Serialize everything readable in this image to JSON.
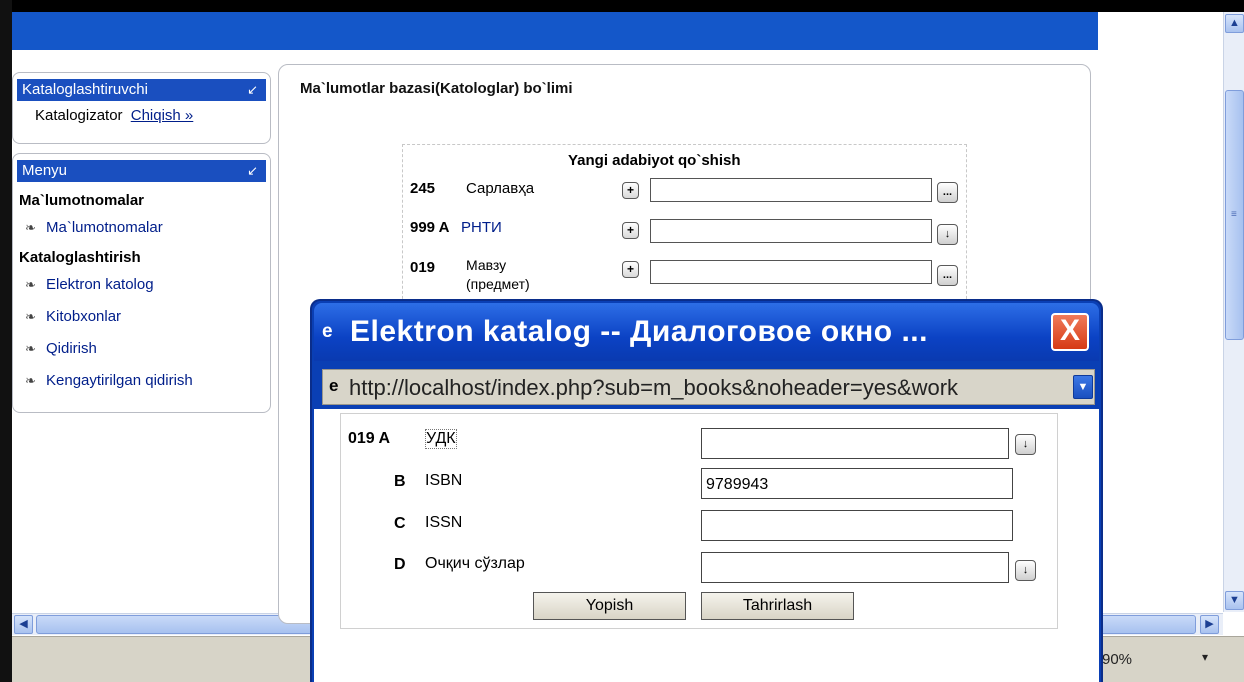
{
  "browser": {
    "zoom": "90%",
    "zoom_dropdown": "▾"
  },
  "user_panel": {
    "title": "Kataloglashtiruvchi",
    "role": "Katalogizator",
    "logout_link": "Chiqish »"
  },
  "menu_panel": {
    "title": "Menyu",
    "sections": [
      {
        "heading": "Ma`lumotnomalar",
        "items": [
          "Ma`lumotnomalar"
        ]
      },
      {
        "heading": "Kataloglashtirish",
        "items": [
          "Elektron katolog",
          "Kitobxonlar",
          "Qidirish",
          "Kengaytirilgan qidirish"
        ]
      }
    ]
  },
  "main": {
    "title": "Ma`lumotlar bazasi(Katologlar) bo`limi",
    "form": {
      "title": "Yangi adabiyot qo`shish",
      "fields": [
        {
          "code": "245",
          "label": "Сарлавҳа",
          "side": "..."
        },
        {
          "code": "999 A",
          "label": "РНТИ",
          "side": "↓"
        },
        {
          "code": "019",
          "label": "Мавзу",
          "label2": "(предмет)",
          "side": "..."
        }
      ]
    }
  },
  "dialog": {
    "title": "Elektron katalog -- Диалоговое окно ...",
    "close": "X",
    "url": "http://localhost/index.php?sub=m_books&noheader=yes&work",
    "rows": [
      {
        "code": "019 A",
        "label": "УДК",
        "value": "",
        "side": "↓"
      },
      {
        "code": "B",
        "label": "ISBN",
        "value": "9789943",
        "side": ""
      },
      {
        "code": "C",
        "label": "ISSN",
        "value": "",
        "side": ""
      },
      {
        "code": "D",
        "label": "Очқич сўзлар",
        "value": "",
        "side": "↓"
      }
    ],
    "buttons": {
      "close": "Yopish",
      "edit": "Tahrirlash"
    }
  }
}
